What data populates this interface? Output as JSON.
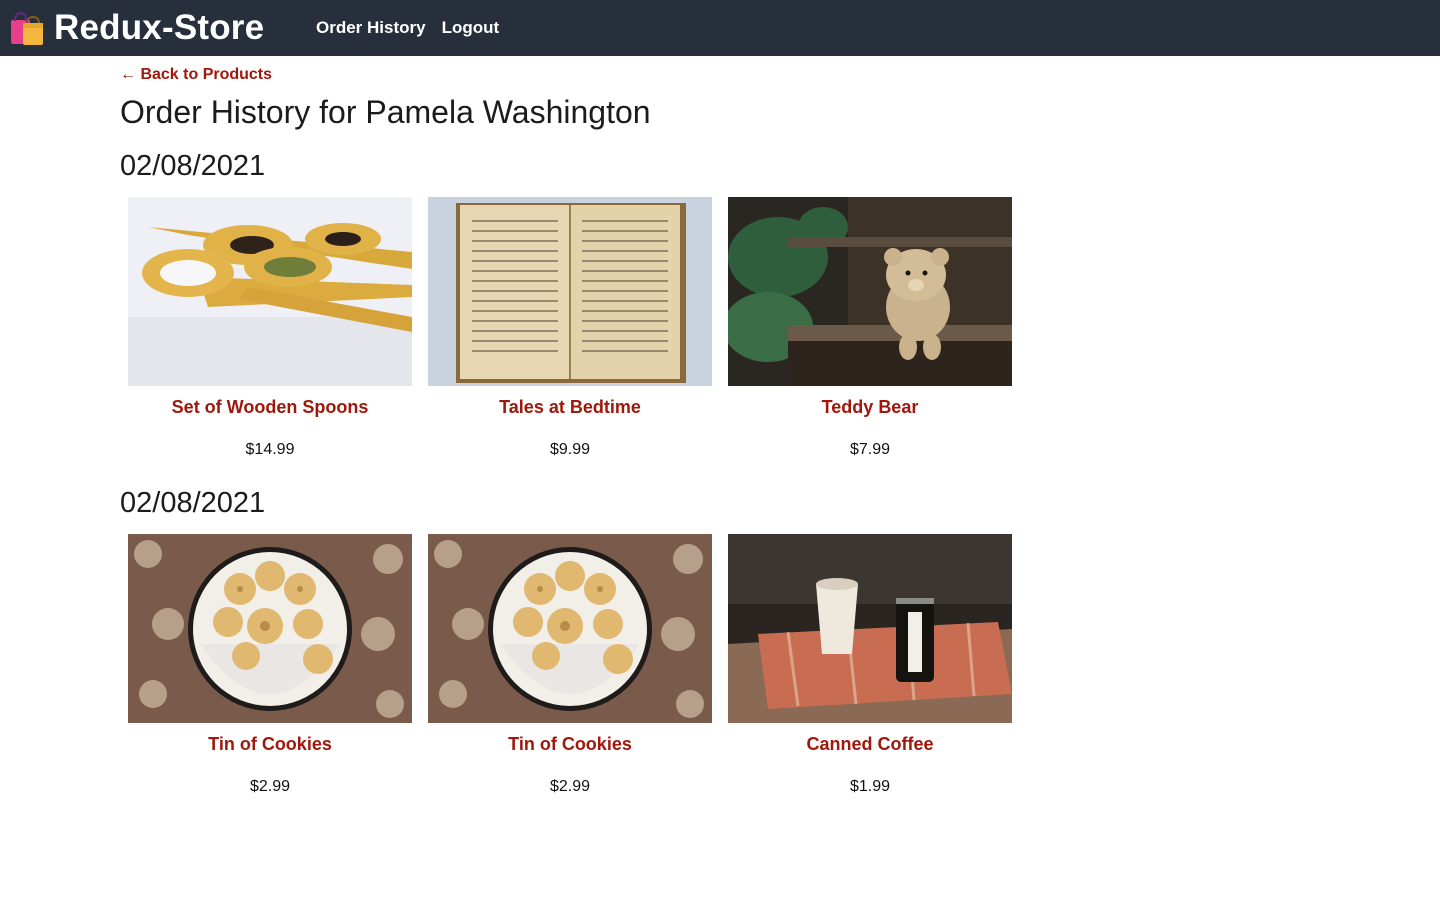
{
  "nav": {
    "brand": "Redux-Store",
    "brand_icon": "shopping-bags-icon",
    "links": [
      "Order History",
      "Logout"
    ],
    "background": "#272f3d"
  },
  "back_link": "← Back to Products",
  "page_title": "Order History for Pamela Washington",
  "accent_color": "#a0170b",
  "orders": [
    {
      "date": "02/08/2021",
      "items": [
        {
          "name": "Set of Wooden Spoons",
          "price": "$14.99",
          "image": "wooden-spoons-image"
        },
        {
          "name": "Tales at Bedtime",
          "price": "$9.99",
          "image": "open-book-image"
        },
        {
          "name": "Teddy Bear",
          "price": "$7.99",
          "image": "teddy-bear-image"
        }
      ]
    },
    {
      "date": "02/08/2021",
      "items": [
        {
          "name": "Tin of Cookies",
          "price": "$2.99",
          "image": "cookie-tin-image"
        },
        {
          "name": "Tin of Cookies",
          "price": "$2.99",
          "image": "cookie-tin-image"
        },
        {
          "name": "Canned Coffee",
          "price": "$1.99",
          "image": "canned-coffee-image"
        }
      ]
    }
  ]
}
